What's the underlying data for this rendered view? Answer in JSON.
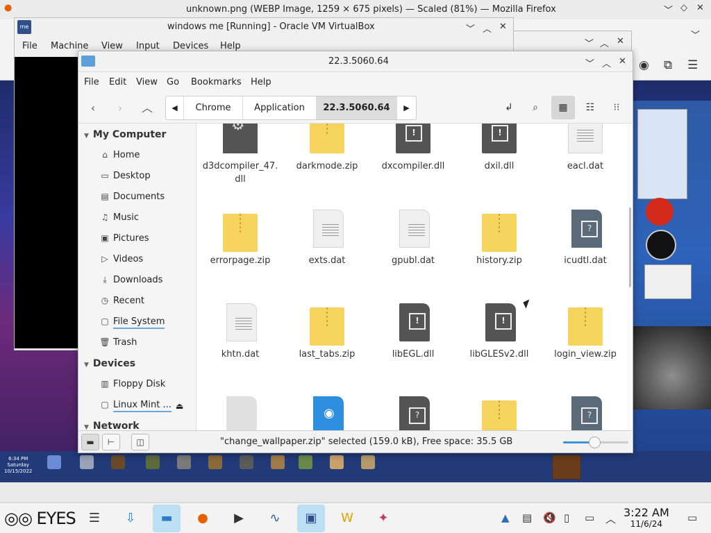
{
  "firefox": {
    "title": "unknown.png (WEBP Image, 1259 × 675 pixels) — Scaled (81%) — Mozilla Firefox"
  },
  "virtualbox": {
    "title": "windows me [Running] - Oracle VM VirtualBox",
    "logo_text": "me",
    "menu": [
      "File",
      "Machine",
      "View",
      "Input",
      "Devices",
      "Help"
    ]
  },
  "nemo": {
    "title": "22.3.5060.64",
    "menu": [
      "File",
      "Edit",
      "View",
      "Go",
      "Bookmarks",
      "Help"
    ],
    "breadcrumbs": [
      "Chrome",
      "Application",
      "22.3.5060.64"
    ],
    "sidebar": {
      "sections": [
        {
          "title": "My Computer",
          "items": [
            {
              "label": "Home",
              "icon": "home-icon"
            },
            {
              "label": "Desktop",
              "icon": "desktop-icon"
            },
            {
              "label": "Documents",
              "icon": "documents-icon"
            },
            {
              "label": "Music",
              "icon": "music-icon"
            },
            {
              "label": "Pictures",
              "icon": "pictures-icon"
            },
            {
              "label": "Videos",
              "icon": "videos-icon"
            },
            {
              "label": "Downloads",
              "icon": "downloads-icon"
            },
            {
              "label": "Recent",
              "icon": "recent-icon"
            },
            {
              "label": "File System",
              "icon": "filesystem-icon"
            },
            {
              "label": "Trash",
              "icon": "trash-icon"
            }
          ]
        },
        {
          "title": "Devices",
          "items": [
            {
              "label": "Floppy Disk",
              "icon": "floppy-icon"
            },
            {
              "label": "Linux Mint ...",
              "icon": "drive-icon"
            }
          ]
        },
        {
          "title": "Network",
          "items": []
        }
      ]
    },
    "files": [
      {
        "name": "d3dcompiler_47.\ndll",
        "type": "gear"
      },
      {
        "name": "darkmode.zip",
        "type": "zip"
      },
      {
        "name": "dxcompiler.dll",
        "type": "dll"
      },
      {
        "name": "dxil.dll",
        "type": "dll"
      },
      {
        "name": "eacl.dat",
        "type": "dat"
      },
      {
        "name": "errorpage.zip",
        "type": "zip"
      },
      {
        "name": "exts.dat",
        "type": "dat"
      },
      {
        "name": "gpubl.dat",
        "type": "dat"
      },
      {
        "name": "history.zip",
        "type": "zip"
      },
      {
        "name": "icudtl.dat",
        "type": "qdoc"
      },
      {
        "name": "khtn.dat",
        "type": "dat"
      },
      {
        "name": "last_tabs.zip",
        "type": "zip"
      },
      {
        "name": "libEGL.dll",
        "type": "dll"
      },
      {
        "name": "libGLESv2.dll",
        "type": "dll"
      },
      {
        "name": "login_view.zip",
        "type": "zip"
      },
      {
        "name": "",
        "type": "plain"
      },
      {
        "name": "",
        "type": "globe"
      },
      {
        "name": "",
        "type": "qdoc"
      },
      {
        "name": "",
        "type": "zip"
      },
      {
        "name": "",
        "type": "qdoc"
      }
    ],
    "status": "\"change_wallpaper.zip\" selected (159.0 kB), Free space: 35.5 GB",
    "zoom_level": 0.48
  },
  "guest": {
    "clock": "6:34 PM\nSaturday\n10/15/2022"
  },
  "taskbar": {
    "brand": "EYES",
    "time": "3:22 AM",
    "date": "11/6/24"
  }
}
